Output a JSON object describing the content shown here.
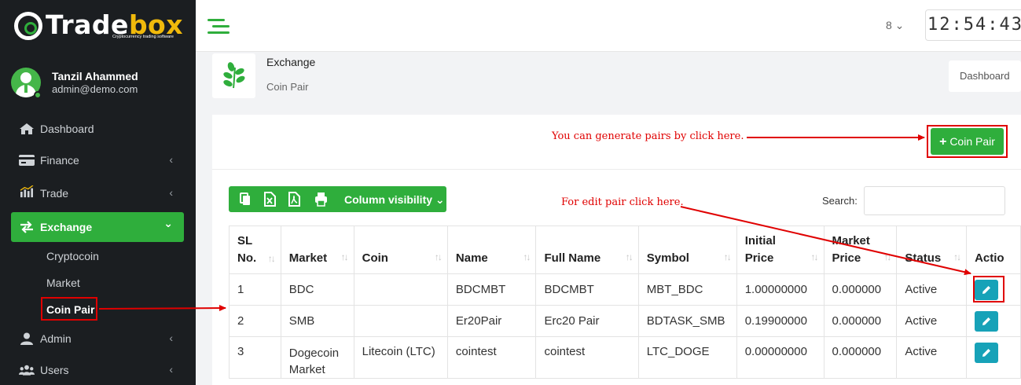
{
  "brand": {
    "name_part1": "Trade",
    "name_part2": "box",
    "tagline": "Cryptocurrency trading software",
    "accent_color": "#2fae3c"
  },
  "user": {
    "name": "Tanzil Ahammed",
    "email": "admin@demo.com"
  },
  "sidebar": {
    "items": [
      {
        "label": "Dashboard",
        "icon": "home-icon"
      },
      {
        "label": "Finance",
        "icon": "credit-card-icon",
        "chevron": "‹"
      },
      {
        "label": "Trade",
        "icon": "chart-icon",
        "chevron": "‹"
      },
      {
        "label": "Exchange",
        "icon": "exchange-arrows-icon",
        "chevron": "⌄",
        "active": true
      },
      {
        "label": "Admin",
        "icon": "user-icon",
        "chevron": "‹"
      },
      {
        "label": "Users",
        "icon": "users-icon",
        "chevron": "‹"
      }
    ],
    "sub_items": [
      "Cryptocoin",
      "Market",
      "Coin Pair"
    ]
  },
  "topbar": {
    "language": "8 ⌄",
    "clock": "12:54:43"
  },
  "page_header": {
    "title": "Exchange",
    "subtitle": "Coin Pair",
    "breadcrumb": "Dashboard"
  },
  "actions": {
    "add_button": "Coin Pair",
    "column_visibility": "Column visibility",
    "search_label": "Search:",
    "search_value": ""
  },
  "annotations": {
    "generate_hint": "You can generate pairs by click here.",
    "edit_hint": "For edit pair click here."
  },
  "table": {
    "headers": [
      "SL No.",
      "Market",
      "Coin",
      "Name",
      "Full Name",
      "Symbol",
      "Initial Price",
      "Market Price",
      "Status",
      "Actio"
    ],
    "rows": [
      {
        "sl": "1",
        "market": "BDC",
        "coin": "",
        "name": "BDCMBT",
        "full_name": "BDCMBT",
        "symbol": "MBT_BDC",
        "initial_price": "1.00000000",
        "market_price": "0.000000",
        "status": "Active"
      },
      {
        "sl": "2",
        "market": "SMB",
        "coin": "",
        "name": "Er20Pair",
        "full_name": "Erc20 Pair",
        "symbol": "BDTASK_SMB",
        "initial_price": "0.19900000",
        "market_price": "0.000000",
        "status": "Active"
      },
      {
        "sl": "3",
        "market": "Dogecoin Market",
        "coin": "Litecoin (LTC)",
        "name": "cointest",
        "full_name": "cointest",
        "symbol": "LTC_DOGE",
        "initial_price": "0.00000000",
        "market_price": "0.000000",
        "status": "Active"
      }
    ]
  }
}
